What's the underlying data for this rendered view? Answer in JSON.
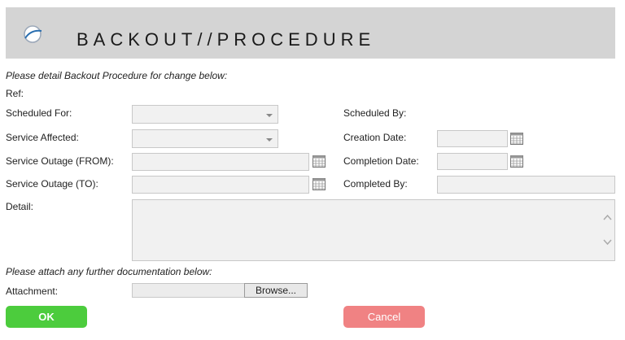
{
  "header": {
    "title": "BACKOUT//PROCEDURE",
    "logo_icon": "swoosh-logo"
  },
  "intro_note": "Please detail Backout Procedure for change below:",
  "fields": {
    "ref_label": "Ref:",
    "scheduled_for_label": "Scheduled For:",
    "scheduled_by_label": "Scheduled By:",
    "service_affected_label": "Service Affected:",
    "creation_date_label": "Creation Date:",
    "service_outage_from_label": "Service Outage (FROM):",
    "completion_date_label": "Completion Date:",
    "service_outage_to_label": "Service Outage (TO):",
    "completed_by_label": "Completed By:",
    "detail_label": "Detail:"
  },
  "attach_note": "Please attach any further documentation below:",
  "attachment": {
    "label": "Attachment:",
    "browse_label": "Browse..."
  },
  "actions": {
    "ok_label": "OK",
    "cancel_label": "Cancel"
  },
  "colors": {
    "header_bg": "#d4d4d4",
    "ok": "#4ccc3d",
    "cancel": "#f08283"
  }
}
